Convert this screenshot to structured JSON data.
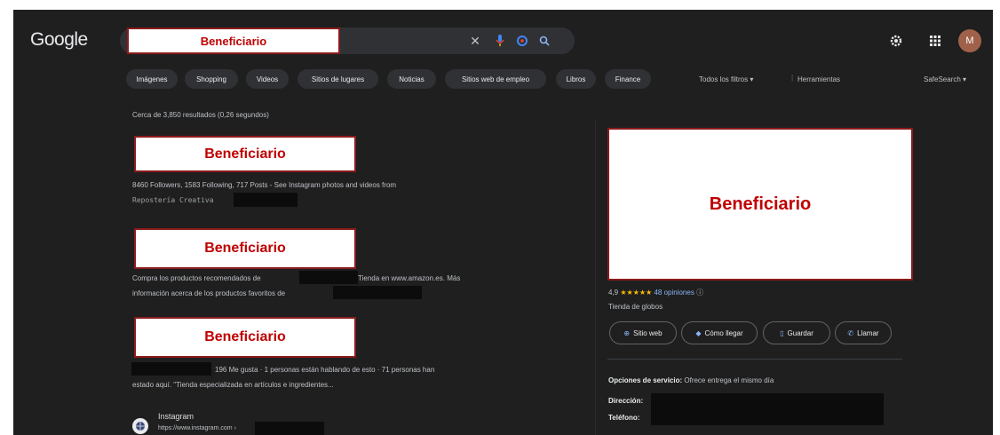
{
  "header": {
    "logo": "Google",
    "search_query": "Beneficiario",
    "avatar_initial": "M",
    "icons": [
      "clear-icon",
      "mic-icon",
      "lens-icon",
      "search-icon",
      "settings-icon",
      "apps-icon"
    ]
  },
  "filters": {
    "chips": [
      "Imágenes",
      "Shopping",
      "Videos",
      "Sitios de lugares",
      "Noticias",
      "Sitios web de empleo",
      "Libros",
      "Finance"
    ],
    "all_filters": "Todos los filtros",
    "tools": "Herramientas",
    "safesearch": "SafeSearch"
  },
  "stats": "Cerca de 3,850 resultados (0,26 segundos)",
  "results": [
    {
      "title": "Beneficiario",
      "snippet_line1": "8460 Followers, 1583 Following, 717 Posts - See Instagram photos and videos from",
      "snippet_line2": "Repostería Creativa"
    },
    {
      "title": "Beneficiario",
      "snippet_line1a": "Compra los productos recomendados de",
      "snippet_line1b": "Tienda en www.amazon.es. Más",
      "snippet_line2": "información acerca de los productos favoritos de"
    },
    {
      "title": "Beneficiario",
      "snippet_line1": "196 Me gusta · 1 personas están hablando de esto · 71 personas han",
      "snippet_line2": "estado aquí. \"Tienda especializada en artículos e ingredientes..."
    }
  ],
  "instagram": {
    "name": "Instagram",
    "url": "https://www.instagram.com ›"
  },
  "knowledge_panel": {
    "title": "Beneficiario",
    "rating": "4,9",
    "stars": "★★★★★",
    "reviews": "48 opiniones",
    "category": "Tienda de globos",
    "buttons": [
      "Sitio web",
      "Cómo llegar",
      "Guardar",
      "Llamar"
    ],
    "service_label": "Opciones de servicio:",
    "service_value": "Ofrece entrega el mismo día",
    "address_label": "Dirección:",
    "phone_label": "Teléfono:"
  },
  "colors": {
    "background": "#1f1f1f",
    "chip": "#303134",
    "link": "#8ab4f8",
    "redaction_text": "#c00000",
    "star": "#fbbc04"
  }
}
